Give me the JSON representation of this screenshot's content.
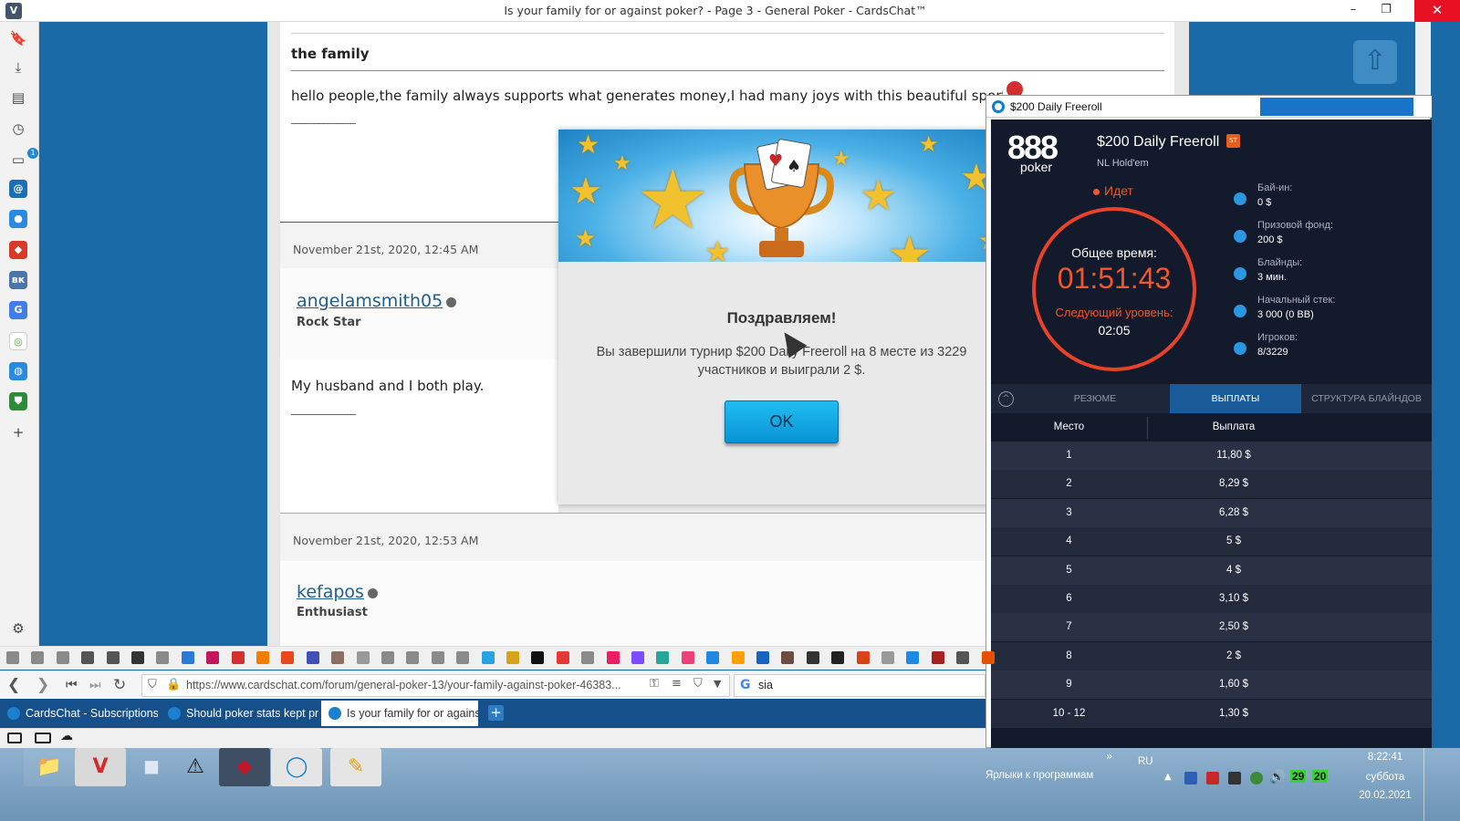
{
  "browser": {
    "window_title": "Is your family for or against poker? - Page 3 - General Poker - CardsChat™",
    "logo": "V",
    "minimize": "–",
    "maximize": "❐",
    "close": "✕"
  },
  "sidepanel": {
    "badge": "1",
    "add": "+"
  },
  "post": {
    "heading": "the family",
    "text": "hello people,the family always supports what generates money,I had many joys with this beautiful sport,and yes.",
    "signature": "______________"
  },
  "posts": [
    {
      "date": "November 21st, 2020, 12:45 AM",
      "username": "angelamsmith05",
      "rank": "Rock Star",
      "text": "My husband and I both play.",
      "signature": "______________"
    },
    {
      "date": "November 21st, 2020, 12:53 AM",
      "username": "kefapos",
      "rank": "Enthusiast"
    }
  ],
  "popup": {
    "congrats": "Поздравляем!",
    "message": "Вы завершили турнир $200 Daily Freeroll на 8 месте из 3229 участников и выиграли 2 $.",
    "ok_label": "OK"
  },
  "poker": {
    "window_title": "$200 Daily Freeroll",
    "logo_top": "888",
    "logo_bottom": "poker",
    "tournament_name": "$200 Daily Freeroll",
    "badge": "ST",
    "game": "NL Hold'em",
    "status": "Идет",
    "total_time_label": "Общее время:",
    "total_time": "01:51:43",
    "next_level_label": "Следующий уровень:",
    "next_level": "02:05",
    "info": [
      {
        "label": "Бай-ин:",
        "value": "0 $",
        "icon": "chip-icon"
      },
      {
        "label": "Призовой фонд:",
        "value": "200 $",
        "icon": "trophy-icon"
      },
      {
        "label": "Блайнды:",
        "value": "3 мин.",
        "icon": "clock-icon"
      },
      {
        "label": "Начальный стек:",
        "value": "3 000 (0 BB)",
        "icon": "stack-icon"
      },
      {
        "label": "Игроков:",
        "value": "8/3229",
        "icon": "player-icon"
      }
    ],
    "tabs": [
      "РЕЗЮМЕ",
      "ВЫПЛАТЫ",
      "СТРУКТУРА БЛАЙНДОВ"
    ],
    "active_tab": 1,
    "table_headers": [
      "Место",
      "Выплата"
    ],
    "payouts": [
      [
        "1",
        "11,80 $"
      ],
      [
        "2",
        "8,29 $"
      ],
      [
        "3",
        "6,28 $"
      ],
      [
        "4",
        "5 $"
      ],
      [
        "5",
        "4 $"
      ],
      [
        "6",
        "3,10 $"
      ],
      [
        "7",
        "2,50 $"
      ],
      [
        "8",
        "2 $"
      ],
      [
        "9",
        "1,60 $"
      ],
      [
        "10 - 12",
        "1,30 $"
      ]
    ]
  },
  "addressbar": {
    "url": "https://www.cardschat.com/forum/general-poker-13/your-family-against-poker-46383...",
    "search": "sia",
    "search_engine": "G"
  },
  "tabs": [
    {
      "title": "CardsChat - Subscriptions"
    },
    {
      "title": "Should poker stats kept pri"
    },
    {
      "title": "Is your family for or agains"
    }
  ],
  "new_tab": "+",
  "taskbar": {
    "links": "Ярлыки к программам",
    "chevron": "»",
    "lang": "RU",
    "time": "8:22:41",
    "day": "суббота",
    "date": "20.02.2021",
    "tray_num1": "29",
    "tray_num2": "20"
  },
  "colors": {
    "site_blue": "#1a6aa8",
    "poker_bg": "#121a2b",
    "poker_accent": "#f1562d",
    "active_tab": "#1a5b99",
    "ok_button": "#0a93d4"
  }
}
